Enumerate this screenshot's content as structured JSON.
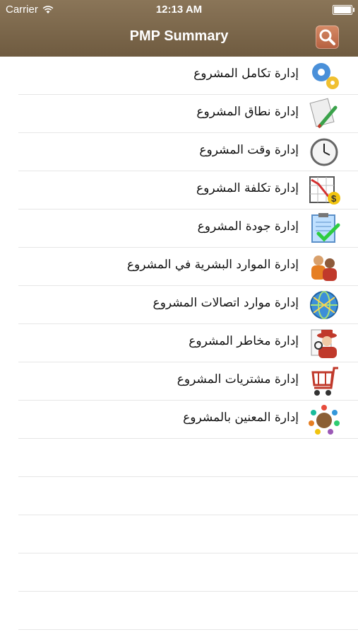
{
  "status_bar": {
    "carrier": "Carrier",
    "time": "12:13 AM"
  },
  "nav": {
    "title": "PMP Summary",
    "search_icon": "search-icon"
  },
  "items": [
    {
      "label": "إدارة تكامل المشروع",
      "icon": "gears-icon"
    },
    {
      "label": "إدارة نطاق المشروع",
      "icon": "document-pen-icon"
    },
    {
      "label": "إدارة وقت المشروع",
      "icon": "clock-icon"
    },
    {
      "label": "إدارة تكلفة المشروع",
      "icon": "cost-chart-icon"
    },
    {
      "label": "إدارة جودة المشروع",
      "icon": "quality-checklist-icon"
    },
    {
      "label": "إدارة الموارد البشرية في المشروع",
      "icon": "people-icon"
    },
    {
      "label": "إدارة موارد اتصالات المشروع",
      "icon": "globe-network-icon"
    },
    {
      "label": "إدارة مخاطر المشروع",
      "icon": "risk-spy-icon"
    },
    {
      "label": "إدارة مشتريات المشروع",
      "icon": "shopping-cart-icon"
    },
    {
      "label": "إدارة المعنين بالمشروع",
      "icon": "stakeholders-icon"
    }
  ],
  "colors": {
    "nav_bar": "#7d684c",
    "separator": "#e6e6e6",
    "search_button": "#c8714f"
  }
}
